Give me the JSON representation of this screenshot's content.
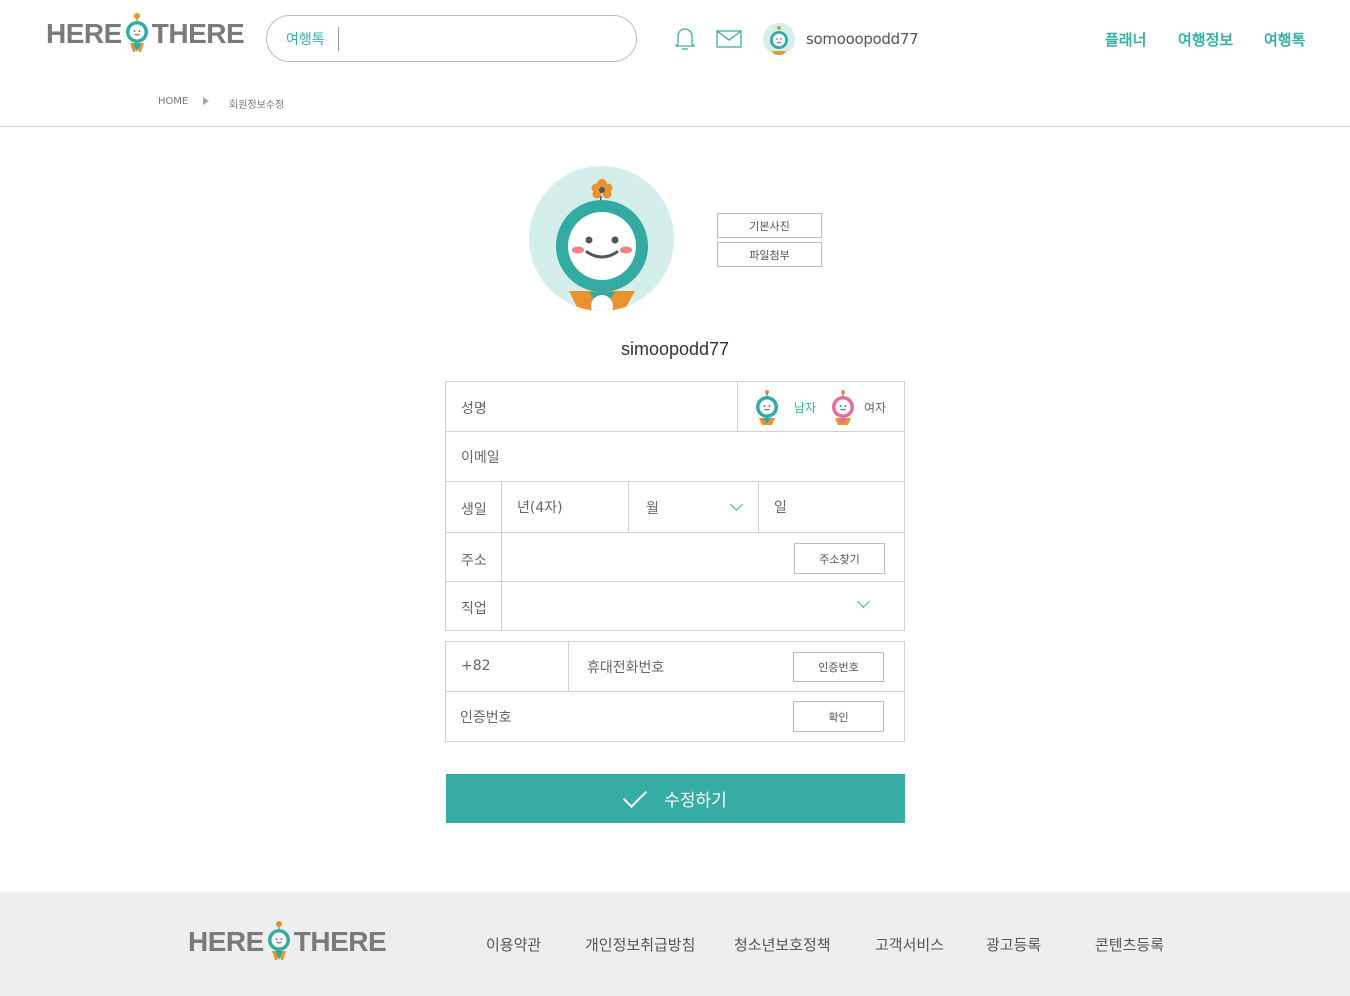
{
  "header": {
    "logo_left": "HERE",
    "logo_right": "THERE",
    "search_category": "여행톡",
    "username": "somooopodd77",
    "nav": [
      "플래너",
      "여행정보",
      "여행톡"
    ]
  },
  "breadcrumb": {
    "home": "HOME",
    "current": "회원정보수정"
  },
  "profile": {
    "default_photo_button": "기본사진",
    "attach_file_button": "파일첨부",
    "username": "simoopodd77"
  },
  "form": {
    "name_label": "성명",
    "gender_male": "남자",
    "gender_female": "여자",
    "email_label": "이메일",
    "birth_label": "생일",
    "birth_year_placeholder": "년(4자)",
    "birth_month_placeholder": "월",
    "birth_day_placeholder": "일",
    "address_label": "주소",
    "address_search_button": "주소찾기",
    "job_label": "직업",
    "country_code": "+82",
    "phone_placeholder": "휴대전화번호",
    "request_code_button": "인증번호",
    "verify_label": "인증번호",
    "confirm_button": "확인",
    "submit_label": "수정하기"
  },
  "footer": {
    "logo_left": "HERE",
    "logo_right": "THERE",
    "links": [
      "이용약관",
      "개인정보취급방침",
      "청소년보호정책",
      "고객서비스",
      "광고등록",
      "콘텐츠등록"
    ]
  },
  "colors": {
    "accent": "#37aca4",
    "mascot_teal": "#33aba3",
    "mascot_pink": "#e0709a",
    "flower": "#e8932b"
  }
}
